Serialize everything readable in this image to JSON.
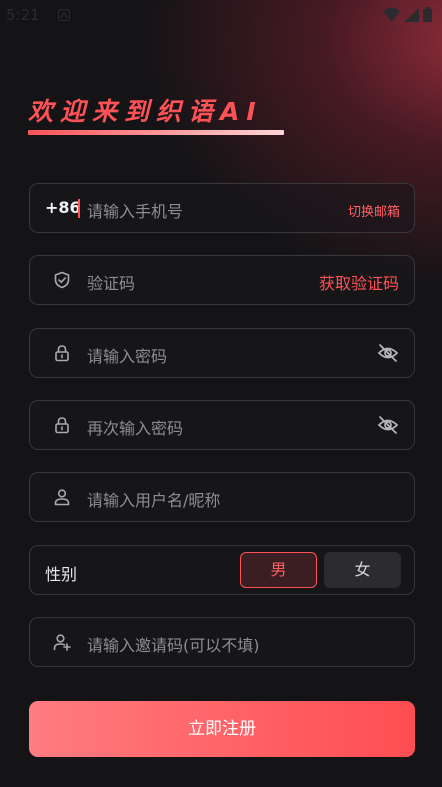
{
  "status_bar": {
    "time": "5:21"
  },
  "title": "欢迎来到织语AI",
  "phone": {
    "country_code": "+86",
    "placeholder": "请输入手机号",
    "switch_label": "切换邮箱"
  },
  "code": {
    "placeholder": "验证码",
    "get_code_label": "获取验证码"
  },
  "password": {
    "placeholder": "请输入密码"
  },
  "confirm_password": {
    "placeholder": "再次输入密码"
  },
  "username": {
    "placeholder": "请输入用户名/昵称"
  },
  "gender": {
    "label": "性别",
    "options": [
      "男",
      "女"
    ],
    "selected": "男"
  },
  "invite": {
    "placeholder": "请输入邀请码(可以不填)"
  },
  "submit_label": "立即注册",
  "colors": {
    "accent": "#ff5257",
    "background": "#141416",
    "field_border": "#38383c"
  },
  "icons": [
    "shield-icon",
    "lock-icon",
    "eye-off-icon",
    "user-icon",
    "user-add-icon",
    "wifi-icon",
    "signal-icon",
    "battery-icon"
  ]
}
